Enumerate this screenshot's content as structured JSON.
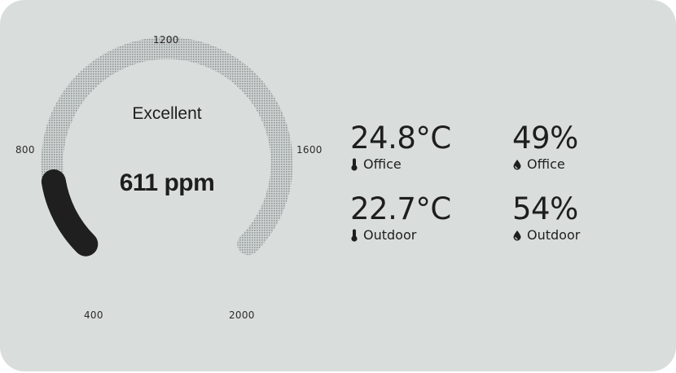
{
  "gauge": {
    "status": "Excellent",
    "value_text": "611 ppm",
    "value": 611,
    "min": 400,
    "max": 2000,
    "ticks": {
      "t1200": "1200",
      "t800": "800",
      "t1600": "1600",
      "t400": "400",
      "t2000": "2000"
    },
    "track_color": "#a9aeae",
    "fill_color": "#1e1f1e"
  },
  "readings": [
    {
      "value": "24.8°C",
      "label": "Office",
      "icon": "thermometer-icon"
    },
    {
      "value": "49%",
      "label": "Office",
      "icon": "humidity-drop-icon"
    },
    {
      "value": "22.7°C",
      "label": "Outdoor",
      "icon": "thermometer-icon"
    },
    {
      "value": "54%",
      "label": "Outdoor",
      "icon": "humidity-drop-icon"
    }
  ],
  "colors": {
    "card_background": "#d9dedd",
    "text": "#1e1e1e"
  }
}
